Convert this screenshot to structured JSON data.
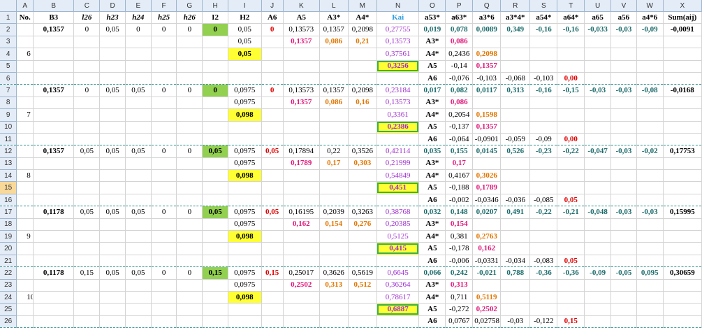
{
  "columns": [
    "A",
    "B",
    "C",
    "D",
    "E",
    "F",
    "G",
    "H",
    "I",
    "J",
    "K",
    "L",
    "M",
    "N",
    "O",
    "P",
    "Q",
    "R",
    "S",
    "T",
    "U",
    "V",
    "W",
    "X"
  ],
  "headers": {
    "a": "No.",
    "b": "B3",
    "c": "l26",
    "d": "h23",
    "e": "h24",
    "f": "h25",
    "g": "h26",
    "h": "I2",
    "i": "H2",
    "j": "A6",
    "k": "A5",
    "l": "A3*",
    "m": "A4*",
    "n": "Kai",
    "o": "a53*",
    "p": "a63*",
    "q": "a3*6",
    "r": "a3*4*",
    "s": "a54*",
    "t": "a64*",
    "u": "a65",
    "v": "a56",
    "w": "a4*6",
    "x": "Sum(aij)"
  },
  "rows": {
    "r2": [
      "0,1357",
      "0",
      "0,05",
      "0",
      "0",
      "0",
      "0",
      "0,05",
      "0",
      "0,13573",
      "0,1357",
      "0,2098",
      "0,27755",
      "0,019",
      "0,078",
      "0,0089",
      "0,349",
      "-0,16",
      "-0,16",
      "-0,033",
      "-0,03",
      "-0,09",
      "-0,0091"
    ],
    "r3": [
      "0,05",
      "0,1357",
      "0,086",
      "0,21",
      "0,13573",
      "A3*",
      "0,086"
    ],
    "r4": [
      "0,05",
      "0,37561",
      "A4*",
      "0,2436",
      "0,2098"
    ],
    "r5": [
      "0,3256",
      "A5",
      "-0,14",
      "0,1357"
    ],
    "r6": [
      "A6",
      "-0,076",
      "-0,103",
      "-0,068",
      "-0,103",
      "0,00"
    ],
    "r7": [
      "0,1357",
      "0",
      "0,05",
      "0,05",
      "0",
      "0",
      "0",
      "0,0975",
      "0",
      "0,13573",
      "0,1357",
      "0,2098",
      "0,23184",
      "0,017",
      "0,082",
      "0,0117",
      "0,313",
      "-0,16",
      "-0,15",
      "-0,03",
      "-0,03",
      "-0,08",
      "-0,0168"
    ],
    "r8": [
      "0,0975",
      "0,1357",
      "0,086",
      "0,16",
      "0,13573",
      "A3*",
      "0,086"
    ],
    "r9": [
      "0,098",
      "0,3361",
      "A4*",
      "0,2054",
      "0,1598"
    ],
    "r10": [
      "0,2386",
      "A5",
      "-0,137",
      "0,1357"
    ],
    "r11": [
      "A6",
      "-0,064",
      "-0,0901",
      "-0,059",
      "-0,09",
      "0,00"
    ],
    "r12": [
      "0,1357",
      "0,05",
      "0,05",
      "0,05",
      "0",
      "0",
      "0,05",
      "0,0975",
      "0,05",
      "0,17894",
      "0,22",
      "0,3526",
      "0,42114",
      "0,035",
      "0,155",
      "0,0145",
      "0,526",
      "-0,23",
      "-0,22",
      "-0,047",
      "-0,03",
      "-0,02",
      "0,17753"
    ],
    "r13": [
      "0,0975",
      "0,1789",
      "0,17",
      "0,303",
      "0,21999",
      "A3*",
      "0,17"
    ],
    "r14": [
      "0,098",
      "0,54849",
      "A4*",
      "0,4167",
      "0,3026"
    ],
    "r15": [
      "0,451",
      "A5",
      "-0,188",
      "0,1789"
    ],
    "r16": [
      "A6",
      "-0,002",
      "-0,0346",
      "-0,036",
      "-0,085",
      "0,05"
    ],
    "r17": [
      "0,1178",
      "0,05",
      "0,05",
      "0,05",
      "0",
      "0",
      "0,05",
      "0,0975",
      "0,05",
      "0,16195",
      "0,2039",
      "0,3263",
      "0,38768",
      "0,032",
      "0,148",
      "0,0207",
      "0,491",
      "-0,22",
      "-0,21",
      "-0,048",
      "-0,03",
      "-0,03",
      "0,15995"
    ],
    "r18": [
      "0,0975",
      "0,162",
      "0,154",
      "0,276",
      "0,20385",
      "A3*",
      "0,154"
    ],
    "r19": [
      "0,098",
      "0,5125",
      "A4*",
      "0,381",
      "0,2763"
    ],
    "r20": [
      "0,415",
      "A5",
      "-0,178",
      "0,162"
    ],
    "r21": [
      "A6",
      "-0,006",
      "-0,0331",
      "-0,034",
      "-0,083",
      "0,05"
    ],
    "r22": [
      "0,1178",
      "0,15",
      "0,05",
      "0,05",
      "0",
      "0",
      "0,15",
      "0,0975",
      "0,15",
      "0,25017",
      "0,3626",
      "0,5619",
      "0,6645",
      "0,066",
      "0,242",
      "-0,021",
      "0,788",
      "-0,36",
      "-0,36",
      "-0,09",
      "-0,05",
      "0,095",
      "0,30659"
    ],
    "r23": [
      "0,0975",
      "0,2502",
      "0,313",
      "0,512",
      "0,36264",
      "A3*",
      "0,313"
    ],
    "r24": [
      "0,098",
      "0,78617",
      "A4*",
      "0,711",
      "0,5119"
    ],
    "r25": [
      "0,6887",
      "A5",
      "-0,272",
      "0,2502"
    ],
    "r26": [
      "A6",
      "0,0767",
      "0,02758",
      "-0,03",
      "-0,122",
      "0,15"
    ]
  },
  "groups": [
    "6",
    "7",
    "8",
    "9",
    "10"
  ]
}
